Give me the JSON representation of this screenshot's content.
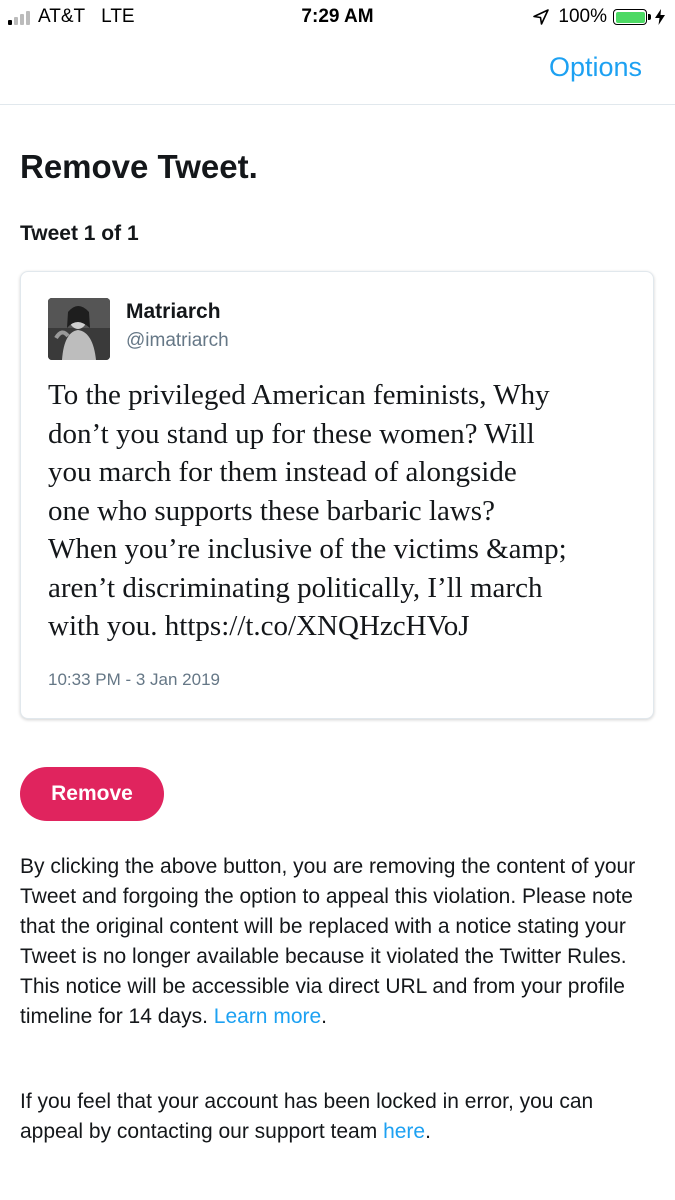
{
  "status_bar": {
    "carrier": "AT&T",
    "network": "LTE",
    "time": "7:29 AM",
    "battery_percent": "100%",
    "battery_level": 1.0,
    "signal_bars_filled": 1,
    "signal_bars_total": 4,
    "battery_color": "#4cd964"
  },
  "nav": {
    "options_label": "Options"
  },
  "page": {
    "title": "Remove Tweet.",
    "tweet_counter": "Tweet 1 of 1"
  },
  "tweet": {
    "author_name": "Matriarch",
    "author_handle": "@imatriarch",
    "text_lines": [
      "To the privileged American feminists, Why",
      "don’t you stand up for these women? Will",
      "you march for them instead of alongside",
      "one who supports these barbaric laws?",
      "When you’re inclusive of the victims &amp;",
      "aren’t discriminating politically, I’ll march",
      "with you. https://t.co/XNQHzcHVoJ"
    ],
    "timestamp": "10:33 PM - 3 Jan 2019"
  },
  "actions": {
    "remove_label": "Remove",
    "remove_color": "#e0245e"
  },
  "notice": {
    "paragraph1": "By clicking the above button, you are removing the content of your Tweet and forgoing the option to appeal this violation. Please note that the original content will be replaced with a notice stating your Tweet is no longer available because it violated the Twitter Rules. This notice will be accessible via direct URL and from your profile timeline for 14 days.",
    "learn_more_link": "Learn more",
    "paragraph1_end": ".",
    "paragraph2": "If you feel that your account has been locked in error, you can appeal by contacting our support team",
    "here_link": "here",
    "paragraph2_end": "."
  },
  "colors": {
    "link": "#1da1f2",
    "text": "#14171a",
    "secondary_text": "#657786"
  }
}
